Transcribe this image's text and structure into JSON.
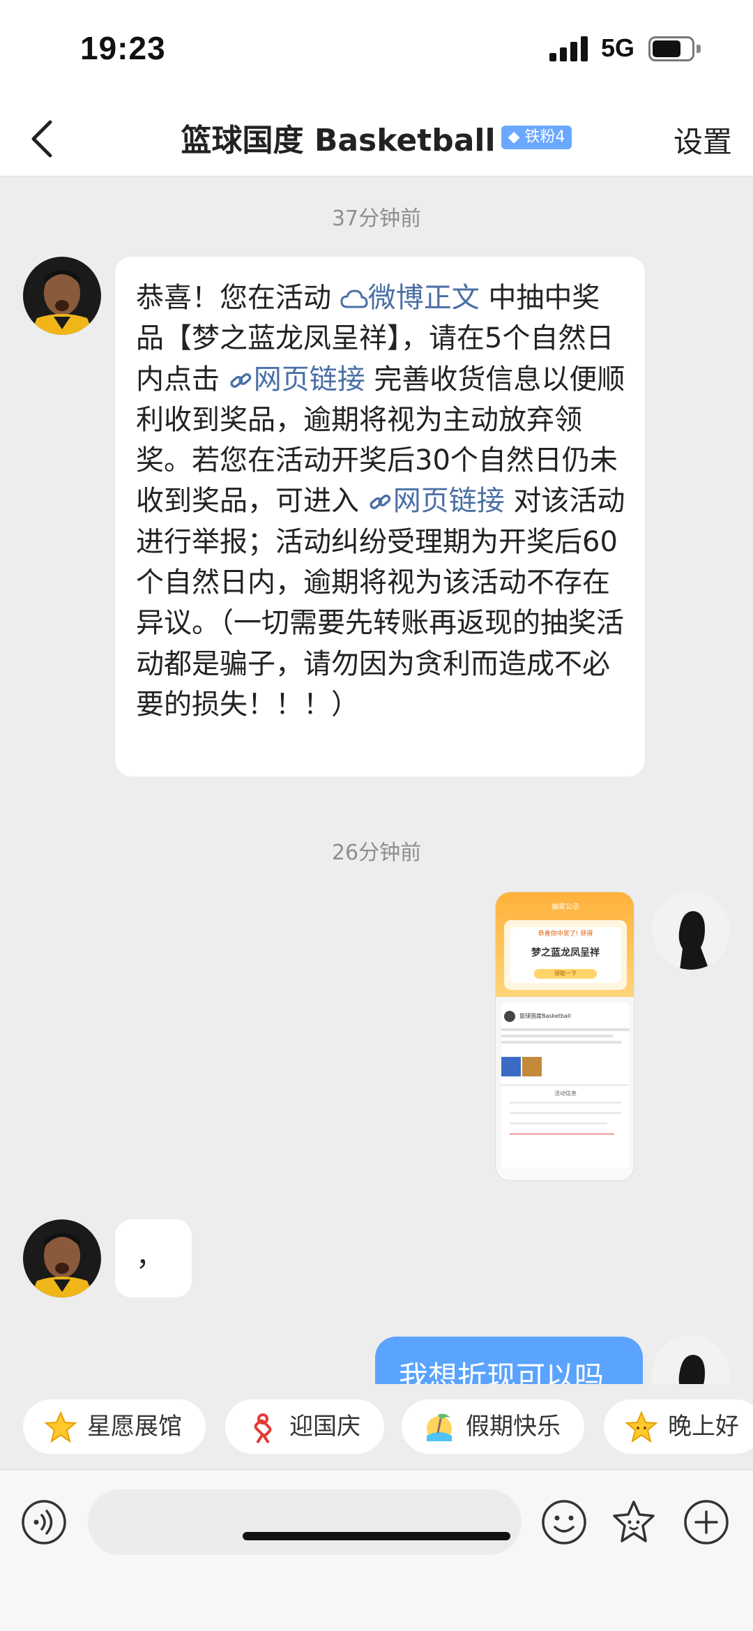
{
  "status_bar": {
    "time": "19:23",
    "network": "5G"
  },
  "header": {
    "title": "篮球国度 Basketball",
    "fan_badge": "铁粉4",
    "settings": "设置"
  },
  "messages": {
    "ts1": "37分钟前",
    "m1": {
      "p1": "恭喜！您在活动 ",
      "link1": "微博正文",
      "p2": " 中抽中奖品【梦之蓝龙凤呈祥】，请在5个自然日内点击 ",
      "link2": "网页链接",
      "p3": " 完善收货信息以便顺利收到奖品，逾期将视为主动放弃领奖。若您在活动开奖后30个自然日仍未收到奖品，可进入 ",
      "link3": "网页链接",
      "p4": " 对该活动进行举报；活动纠纷受理期为开奖后60个自然日内，逾期将视为该活动不存在异议。（一切需要先转账再返现的抽奖活动都是骗子，请勿因为贪利而造成不必要的损失！！！）"
    },
    "ts2": "26分钟前",
    "image_msg": {
      "header": "抽奖公示",
      "congrats": "恭喜你中奖了! 获得",
      "prize": "梦之蓝龙凤呈祥",
      "btn": "领取一下",
      "account": "篮球国度Basketball",
      "section": "活动信息"
    },
    "m2": "，",
    "m3": "我想折现可以吗"
  },
  "chips": [
    {
      "label": "星愿展馆",
      "icon": "star-icon"
    },
    {
      "label": "迎国庆",
      "icon": "knot-icon"
    },
    {
      "label": "假期快乐",
      "icon": "beach-icon"
    },
    {
      "label": "晚上好",
      "icon": "star-icon"
    }
  ],
  "input": {
    "placeholder": ""
  },
  "colors": {
    "link": "#4a6fa5",
    "bubble_right": "#5aa3ff",
    "badge": "#6aa8ff"
  }
}
